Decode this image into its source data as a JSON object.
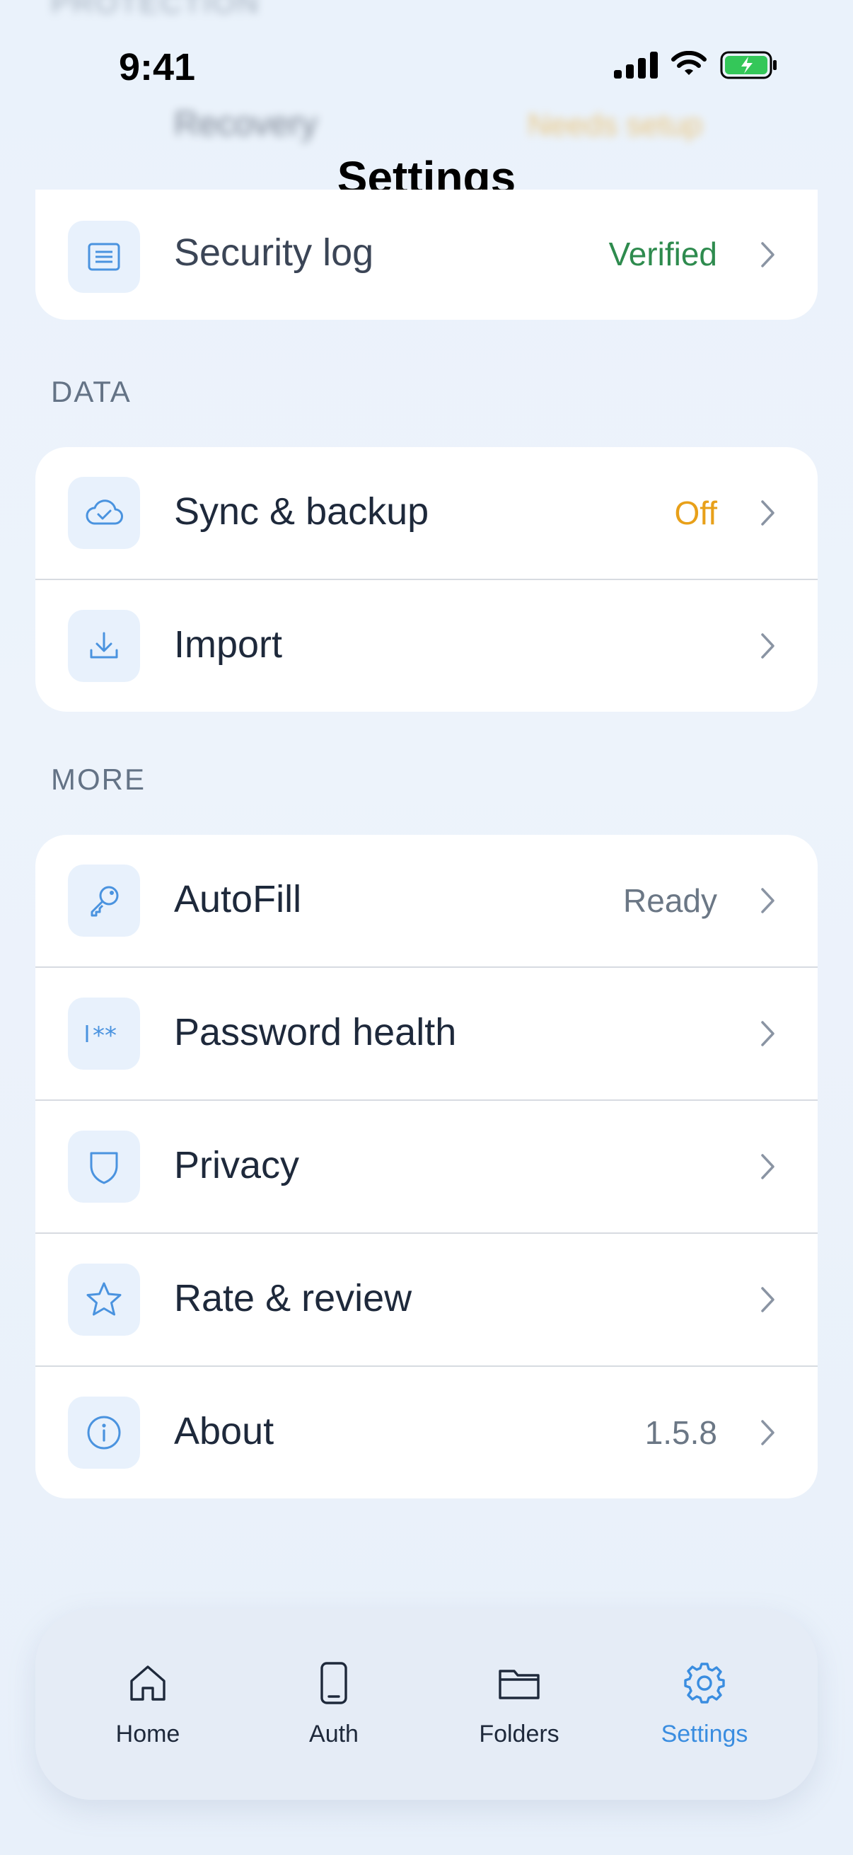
{
  "status_bar": {
    "time": "9:41"
  },
  "nav": {
    "title": "Settings"
  },
  "background_rows": {
    "section": "PROTECTION",
    "recovery_label": "Recovery",
    "recovery_value": "Needs setup"
  },
  "security": {
    "rows": [
      {
        "label": "Security log",
        "value": "Verified",
        "value_color": "#2e8b4e",
        "icon": "list-icon"
      }
    ]
  },
  "data_section": {
    "header": "DATA",
    "rows": [
      {
        "label": "Sync & backup",
        "value": "Off",
        "value_color": "#e8a019",
        "icon": "cloud-check-icon"
      },
      {
        "label": "Import",
        "value": "",
        "icon": "download-icon"
      }
    ]
  },
  "more_section": {
    "header": "MORE",
    "rows": [
      {
        "label": "AutoFill",
        "value": "Ready",
        "value_color": "#6b7785",
        "icon": "key-icon"
      },
      {
        "label": "Password health",
        "value": "",
        "icon": "password-icon"
      },
      {
        "label": "Privacy",
        "value": "",
        "icon": "shield-icon"
      },
      {
        "label": "Rate & review",
        "value": "",
        "icon": "star-icon"
      },
      {
        "label": "About",
        "value": "1.5.8",
        "value_color": "#6b7785",
        "icon": "info-icon"
      }
    ]
  },
  "tabbar": {
    "tabs": [
      {
        "label": "Home",
        "icon": "home-icon"
      },
      {
        "label": "Auth",
        "icon": "phone-icon"
      },
      {
        "label": "Folders",
        "icon": "folder-icon"
      },
      {
        "label": "Settings",
        "icon": "gear-icon",
        "active": true
      }
    ]
  },
  "colors": {
    "accent": "#3a8de0",
    "icon_tile": "#e8f1fc"
  }
}
